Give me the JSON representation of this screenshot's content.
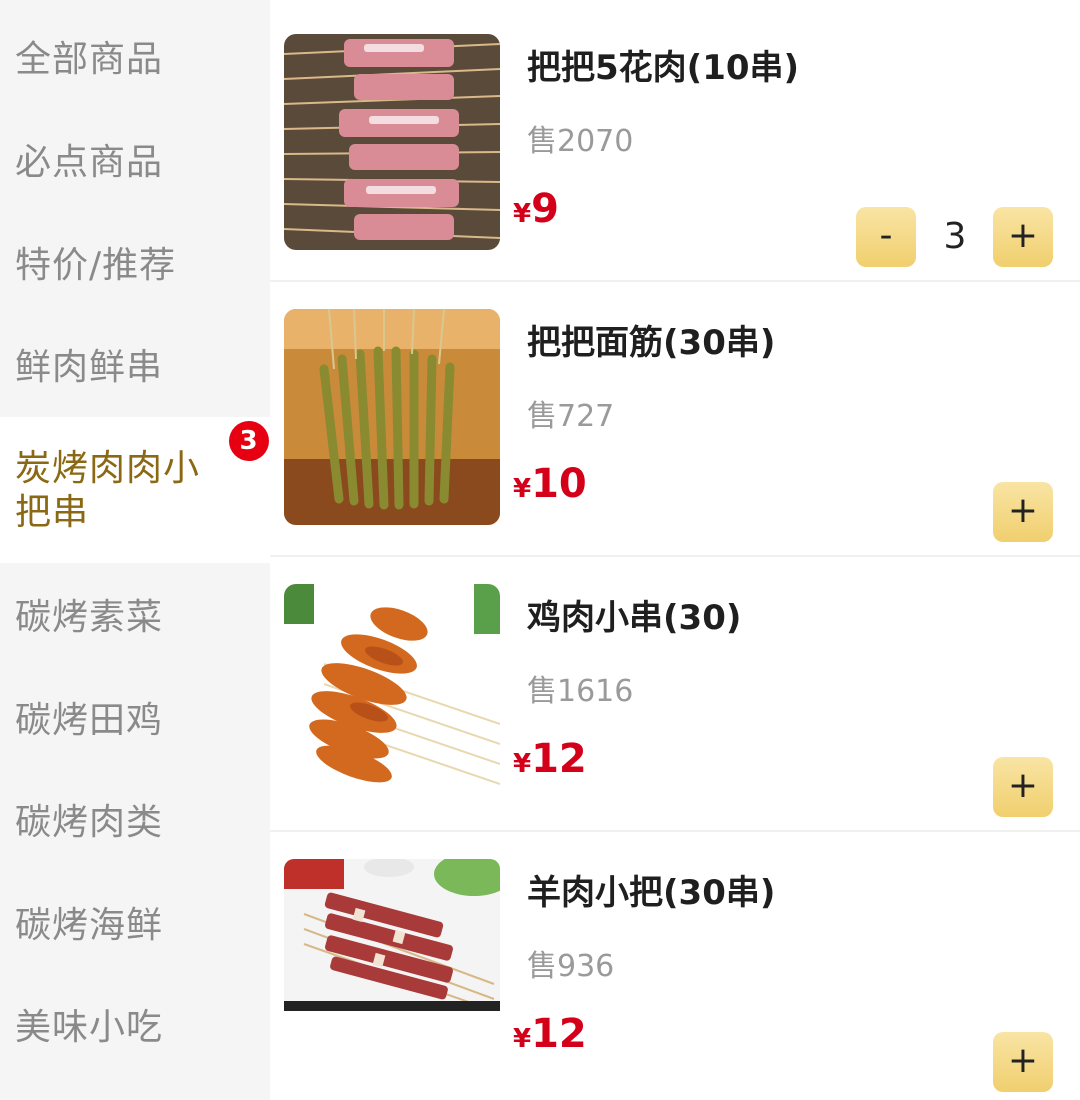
{
  "sidebar": {
    "items": [
      {
        "label": "全部商品"
      },
      {
        "label": "必点商品"
      },
      {
        "label": "特价/推荐"
      },
      {
        "label": "鲜肉鲜串"
      },
      {
        "label": "炭烤肉肉小把串",
        "badge": "3",
        "active": true
      },
      {
        "label": "碳烤素菜"
      },
      {
        "label": "碳烤田鸡"
      },
      {
        "label": "碳烤肉类"
      },
      {
        "label": "碳烤海鲜"
      },
      {
        "label": "美味小吃"
      }
    ]
  },
  "products": [
    {
      "name": "把把5花肉(10串)",
      "sold": "售2070",
      "currency": "¥",
      "price": "9",
      "quantity": "3",
      "minus_label": "-",
      "plus_label": "+"
    },
    {
      "name": "把把面筋(30串)",
      "sold": "售727",
      "currency": "¥",
      "price": "10",
      "plus_label": "+"
    },
    {
      "name": "鸡肉小串(30)",
      "sold": "售1616",
      "currency": "¥",
      "price": "12",
      "plus_label": "+"
    },
    {
      "name": "羊肉小把(30串)",
      "sold": "售936",
      "currency": "¥",
      "price": "12",
      "plus_label": "+"
    }
  ],
  "colors": {
    "active_category": "#8b6914",
    "price": "#d4001a",
    "badge": "#e60012",
    "button_gold": "#f0cf6e"
  }
}
